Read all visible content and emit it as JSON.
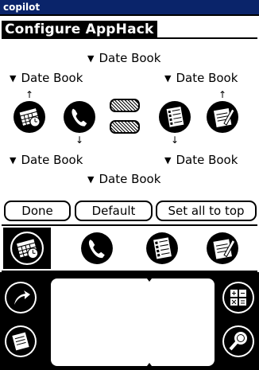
{
  "window": {
    "title": "copilot"
  },
  "form": {
    "title": "Configure AppHack"
  },
  "mappings": {
    "top_center": "Date Book",
    "upper_left": "Date Book",
    "upper_right": "Date Book",
    "lower_left": "Date Book",
    "lower_right": "Date Book",
    "bottom_center": "Date Book"
  },
  "hard_buttons": [
    {
      "name": "datebook",
      "icon": "datebook-icon",
      "arrow": "↑"
    },
    {
      "name": "phone",
      "icon": "phone-icon",
      "arrow": "↓"
    },
    {
      "name": "todo",
      "icon": "todo-icon",
      "arrow": "↓"
    },
    {
      "name": "memo",
      "icon": "memo-icon",
      "arrow": "↑"
    }
  ],
  "buttons": {
    "done": "Done",
    "default": "Default",
    "set_all": "Set all to top"
  },
  "tabs": [
    {
      "name": "datebook",
      "icon": "datebook-icon",
      "active": true
    },
    {
      "name": "phone",
      "icon": "phone-icon",
      "active": false
    },
    {
      "name": "todo",
      "icon": "todo-icon",
      "active": false
    },
    {
      "name": "memo",
      "icon": "memo-icon",
      "active": false
    }
  ],
  "silkscreen": {
    "left_top": "applications-icon",
    "left_bottom": "menu-icon",
    "right_top": "calculator-icon",
    "right_bottom": "find-icon"
  },
  "colors": {
    "titlebar": "#0a246a",
    "black": "#000000",
    "white": "#ffffff"
  }
}
